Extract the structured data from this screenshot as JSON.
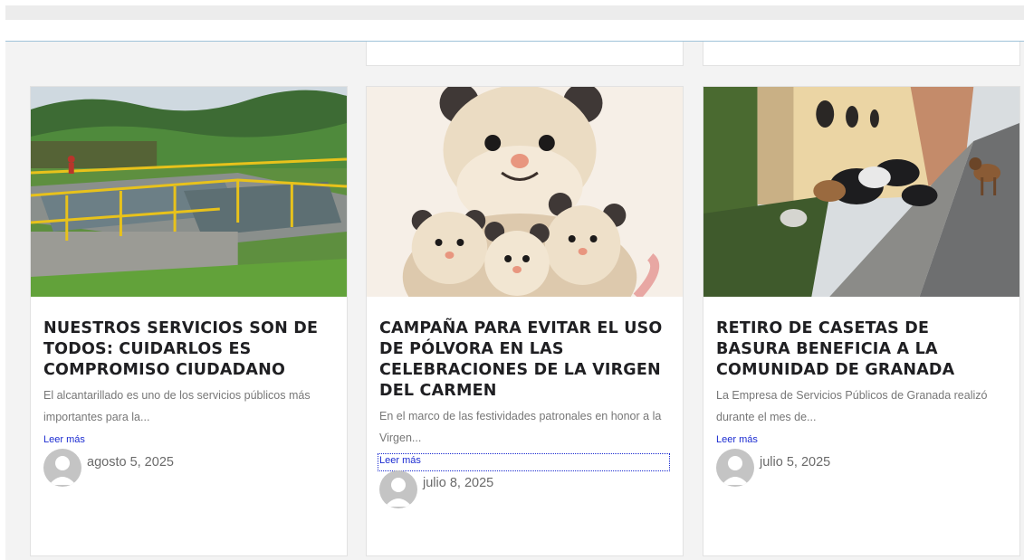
{
  "posts": [
    {
      "title": "NUESTROS SERVICIOS SON DE TODOS: CUIDARLOS ES COMPROMISO CIUDADANO",
      "excerpt": "El alcantarillado es uno de los servicios públicos más importantes para la...",
      "read_more": "Leer más",
      "date": "agosto 5, 2025",
      "image": "water-treatment-plant-photo"
    },
    {
      "title": "CAMPAÑA PARA EVITAR EL USO DE PÓLVORA EN LAS CELEBRACIONES DE LA VIRGEN DEL CARMEN",
      "excerpt": "En el marco de las festividades patronales en honor a la Virgen...",
      "read_more": "Leer más",
      "date": "julio 8, 2025",
      "image": "opossum-family-illustration"
    },
    {
      "title": "RETIRO DE CASETAS DE BASURA BENEFICIA A LA COMUNIDAD DE GRANADA",
      "excerpt": "La Empresa de Servicios Públicos de Granada realizó durante el mes de...",
      "read_more": "Leer más",
      "date": "julio 5, 2025",
      "image": "street-garbage-with-dogs-photo"
    }
  ],
  "colors": {
    "title": "#1f1f22",
    "excerpt": "#777777",
    "link": "#1b2bd1",
    "date": "#6a6a6a",
    "page_bg": "#f3f3f3"
  },
  "icons": {
    "author_avatar": "default-user-avatar-icon"
  }
}
